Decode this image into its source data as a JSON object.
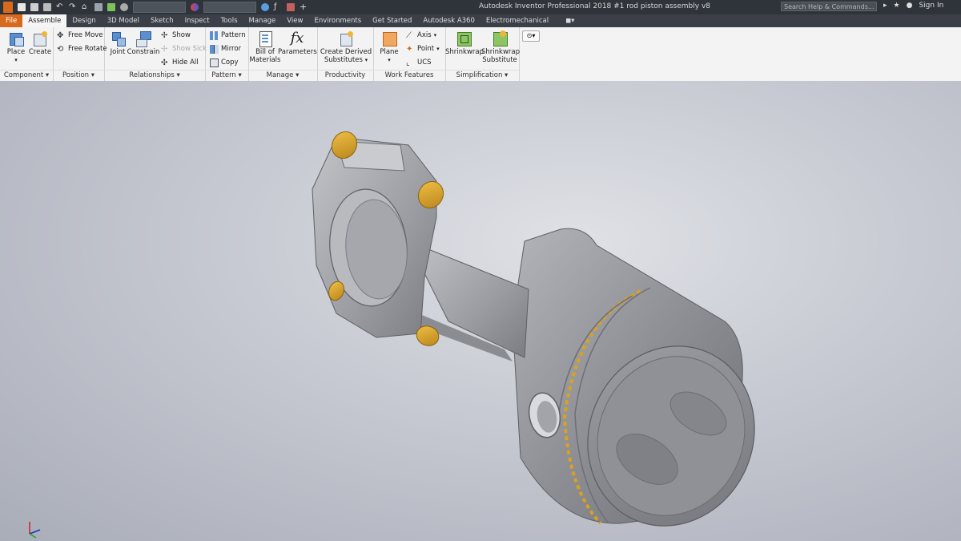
{
  "window": {
    "title": "Autodesk Inventor Professional 2018   #1 rod piston assembly v8",
    "search_placeholder": "Search Help & Commands...",
    "sign_in": "Sign In"
  },
  "tabs": [
    "File",
    "Assemble",
    "Design",
    "3D Model",
    "Sketch",
    "Inspect",
    "Tools",
    "Manage",
    "View",
    "Environments",
    "Get Started",
    "Autodesk A360",
    "Electromechanical"
  ],
  "active_tab": "Assemble",
  "ribbon": {
    "component": {
      "title": "Component",
      "place": "Place",
      "create": "Create"
    },
    "position": {
      "title": "Position",
      "free_move": "Free Move",
      "free_rotate": "Free Rotate"
    },
    "relationships": {
      "title": "Relationships",
      "joint": "Joint",
      "constrain": "Constrain",
      "show": "Show",
      "show_sick": "Show Sick",
      "hide_all": "Hide All"
    },
    "pattern": {
      "title": "Pattern",
      "pattern": "Pattern",
      "mirror": "Mirror",
      "copy": "Copy"
    },
    "manage": {
      "title": "Manage",
      "bom_line1": "Bill of",
      "bom_line2": "Materials",
      "parameters": "Parameters"
    },
    "productivity": {
      "title": "Productivity",
      "cds_line1": "Create Derived",
      "cds_line2": "Substitutes"
    },
    "work_features": {
      "title": "Work Features",
      "plane": "Plane",
      "axis": "Axis",
      "point": "Point",
      "ucs": "UCS"
    },
    "simplification": {
      "title": "Simplification",
      "shrinkwrap": "Shrinkwrap",
      "sws_line1": "Shrinkwrap",
      "sws_line2": "Substitute"
    }
  },
  "colors": {
    "file_tab": "#d96a1d",
    "bolt": "#d9a21f",
    "model": "#8f9197"
  },
  "viewport": {
    "model": "connecting rod and piston assembly",
    "triad": "xyz-triad-icon"
  }
}
